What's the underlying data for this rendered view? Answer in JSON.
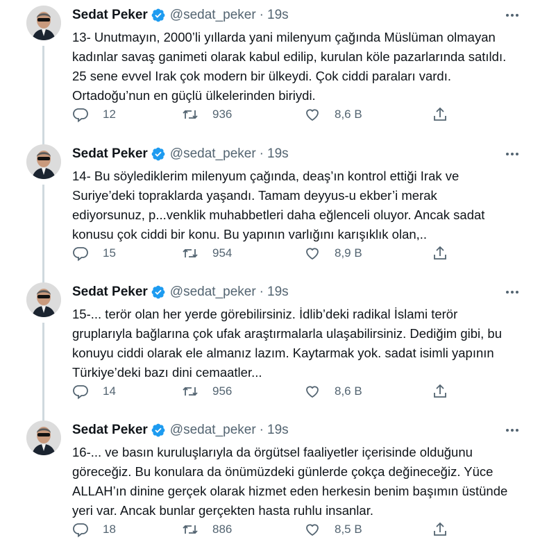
{
  "author": {
    "name": "Sedat Peker",
    "handle": "@sedat_peker",
    "separator": "·",
    "verified": true
  },
  "colors": {
    "verified_badge": "#1d9bf0",
    "secondary_text": "#536471",
    "thread_line": "#cfd9de"
  },
  "icons": [
    "reply-icon",
    "retweet-icon",
    "like-icon",
    "share-icon",
    "verified-badge-icon",
    "more-options-icon"
  ],
  "tweets": [
    {
      "time": "19s",
      "text": "13- Unutmayın, 2000’li yıllarda yani milenyum çağında Müslüman olmayan\nkadınlar savaş ganimeti olarak kabul edilip, kurulan köle pazarlarında satıldı.\n25 sene evvel Irak çok modern bir ülkeydi. Çok ciddi paraları vardı.\nOrtadoğu’nun en güçlü ülkelerinden biriydi.",
      "replies": "12",
      "retweets": "936",
      "likes": "8,6 B"
    },
    {
      "time": "19s",
      "text": "14- Bu söylediklerim milenyum çağında, deaş’ın kontrol ettiği Irak ve\nSuriye’deki topraklarda yaşandı. Tamam deyyus-u ekber’i merak\nediyorsunuz, p...venklik muhabbetleri daha eğlenceli oluyor. Ancak sadat\nkonusu çok ciddi bir konu. Bu yapının varlığını karışıklık olan,..",
      "replies": "15",
      "retweets": "954",
      "likes": "8,9 B"
    },
    {
      "time": "19s",
      "text": "15-... terör olan her yerde görebilirsiniz. İdlib’deki radikal İslami terör\ngruplarıyla bağlarına çok ufak araştırmalarla ulaşabilirsiniz. Dediğim gibi, bu\nkonuyu ciddi olarak ele almanız lazım. Kaytarmak yok. sadat isimli yapının\nTürkiye’deki bazı dini cemaatler...",
      "replies": "14",
      "retweets": "956",
      "likes": "8,6 B"
    },
    {
      "time": "19s",
      "text": "16-... ve basın kuruluşlarıyla da örgütsel faaliyetler içerisinde olduğunu\ngöreceğiz. Bu konulara da önümüzdeki günlerde çokça değineceğiz. Yüce\nALLAH’ın dinine gerçek olarak hizmet eden herkesin benim başımın üstünde\nyeri var. Ancak bunlar gerçekten hasta ruhlu insanlar.",
      "replies": "18",
      "retweets": "886",
      "likes": "8,5 B"
    }
  ]
}
